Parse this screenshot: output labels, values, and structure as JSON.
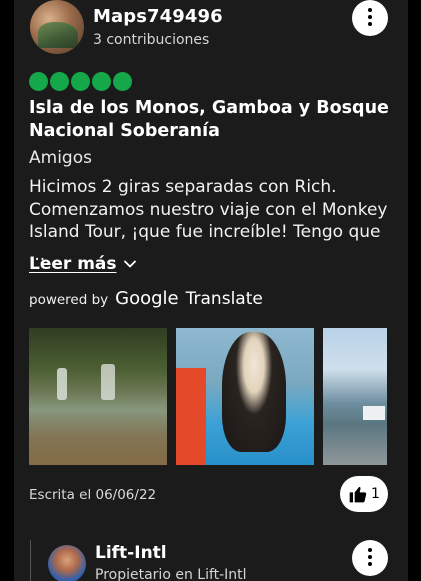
{
  "review": {
    "username": "Maps749496",
    "contributions": "3 contribuciones",
    "rating": 5,
    "title": "Isla de los Monos, Gamboa y Bosque Nacional Soberanía",
    "trip_type": "Amigos",
    "text": "Hicimos 2 giras separadas con Rich. Comenzamos nuestro viaje con el Monkey Island Tour, ¡que fue increíble! Tengo que ...",
    "read_more": "Leer más",
    "powered_by": "powered by",
    "google": "Google",
    "translate": "Translate",
    "written_date": "Escrita el 06/06/22",
    "helpful_count": "1",
    "photos": [
      "waterfall-photo",
      "monkey-photo",
      "canal-locks-photo"
    ]
  },
  "owner_reply": {
    "name": "Lift-Intl",
    "role": "Propietario en Lift-Intl"
  },
  "colors": {
    "rating": "#14a84a",
    "background": "#1b1b1b",
    "text": "#ffffff"
  },
  "icons": [
    "more-vertical-icon",
    "chevron-down-icon",
    "thumbs-up-icon"
  ]
}
